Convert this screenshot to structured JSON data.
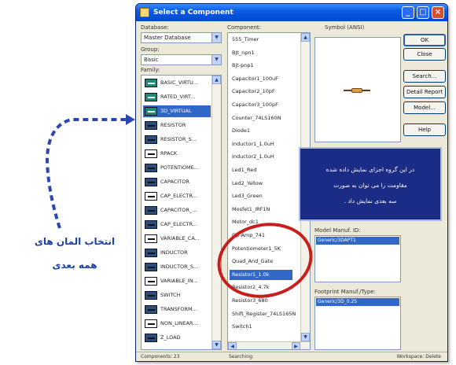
{
  "annotation": {
    "line1": "انتخاب المان های",
    "line2": "همه بعدی"
  },
  "window": {
    "title": "Select a Component",
    "controls": [
      "_",
      "□",
      "×"
    ],
    "labels": {
      "database": "Database:",
      "group": "Group:",
      "family": "Family:",
      "component": "Component:",
      "symbol": "Symbol (ANSI)",
      "model_manuf": "Model Manuf. ID:",
      "footprint": "Footprint Manuf./Type:"
    },
    "database_value": "Master Database",
    "group_value": "Basic",
    "families": [
      {
        "label": "BASIC_VIRTU...",
        "icon": "virtual-teal-icon"
      },
      {
        "label": "RATED_VIRT...",
        "icon": "virtual-teal-icon"
      },
      {
        "label": "3D_VIRTUAL",
        "icon": "virtual-teal-icon",
        "selected": true
      },
      {
        "label": "RESISTOR",
        "icon": "resistor-icon"
      },
      {
        "label": "RESISTOR_S...",
        "icon": "resistor-smd-icon"
      },
      {
        "label": "RPACK",
        "icon": "rpack-icon"
      },
      {
        "label": "POTENTIOME...",
        "icon": "potentiometer-icon"
      },
      {
        "label": "CAPACITOR",
        "icon": "capacitor-icon"
      },
      {
        "label": "CAP_ELECTR...",
        "icon": "electrolytic-capacitor-icon"
      },
      {
        "label": "CAPACITOR_...",
        "icon": "capacitor-variant-icon"
      },
      {
        "label": "CAP_ELECTR...",
        "icon": "electrolytic-capacitor-icon"
      },
      {
        "label": "VARIABLE_CA...",
        "icon": "variable-capacitor-icon"
      },
      {
        "label": "INDUCTOR",
        "icon": "inductor-icon"
      },
      {
        "label": "INDUCTOR_S...",
        "icon": "inductor-smd-icon"
      },
      {
        "label": "VARIABLE_IN...",
        "icon": "variable-inductor-icon"
      },
      {
        "label": "SWITCH",
        "icon": "switch-icon"
      },
      {
        "label": "TRANSFORM...",
        "icon": "transformer-icon"
      },
      {
        "label": "NON_LINEAR...",
        "icon": "nonlinear-icon"
      },
      {
        "label": "Z_LOAD",
        "icon": "zload-icon"
      }
    ],
    "components": [
      {
        "label": "555_Timer"
      },
      {
        "label": "BJt_npn1"
      },
      {
        "label": "Bjt-pnp1"
      },
      {
        "label": "Capacitor1_100uF"
      },
      {
        "label": "Capacitor2_10pF"
      },
      {
        "label": "Capacitor3_100pF"
      },
      {
        "label": "Counter_74LS160N"
      },
      {
        "label": "Diode1"
      },
      {
        "label": "Inductor1_1.0uH"
      },
      {
        "label": "Inductor2_1.0uH"
      },
      {
        "label": "Led1_Red"
      },
      {
        "label": "Led2_Yellow"
      },
      {
        "label": "Led3_Green"
      },
      {
        "label": "Mosfet1_IRF1N"
      },
      {
        "label": "Motor_dc1"
      },
      {
        "label": "Op-Amp_741"
      },
      {
        "label": "Potentiometer1_5K"
      },
      {
        "label": "Quad_And_Gate"
      },
      {
        "label": "Resistor1_1.0k",
        "selected": true
      },
      {
        "label": "Resistor2_4.7k"
      },
      {
        "label": "Resistor3_680"
      },
      {
        "label": "Shift_Register_74LS165N"
      },
      {
        "label": "Switch1"
      }
    ],
    "buttons": [
      {
        "label": "OK",
        "default": true
      },
      {
        "label": "Close"
      },
      {
        "label": "Search..."
      },
      {
        "label": "Detail Report"
      },
      {
        "label": "Model..."
      },
      {
        "label": "Help"
      }
    ],
    "model_manuf_value": "Generic/3DAPT1",
    "footprint_value": "Generic/3D_0.25",
    "note_lines": [
      "در این گروه اجزای نمایش داده شده",
      "مقاومت را می توان به صورت",
      "سه بعدی نمایش داد ."
    ],
    "status": {
      "components": "Components: 23",
      "searching": "Searching:",
      "workspace": "Workspace: Delete"
    }
  },
  "colors": {
    "titlebar": "#0a5ee2",
    "selection": "#3168c8",
    "note_bg": "#1a2c86",
    "ellipse": "#c81e1e",
    "annotation_text": "#1d3fa8",
    "arrow": "#2d47b0"
  }
}
